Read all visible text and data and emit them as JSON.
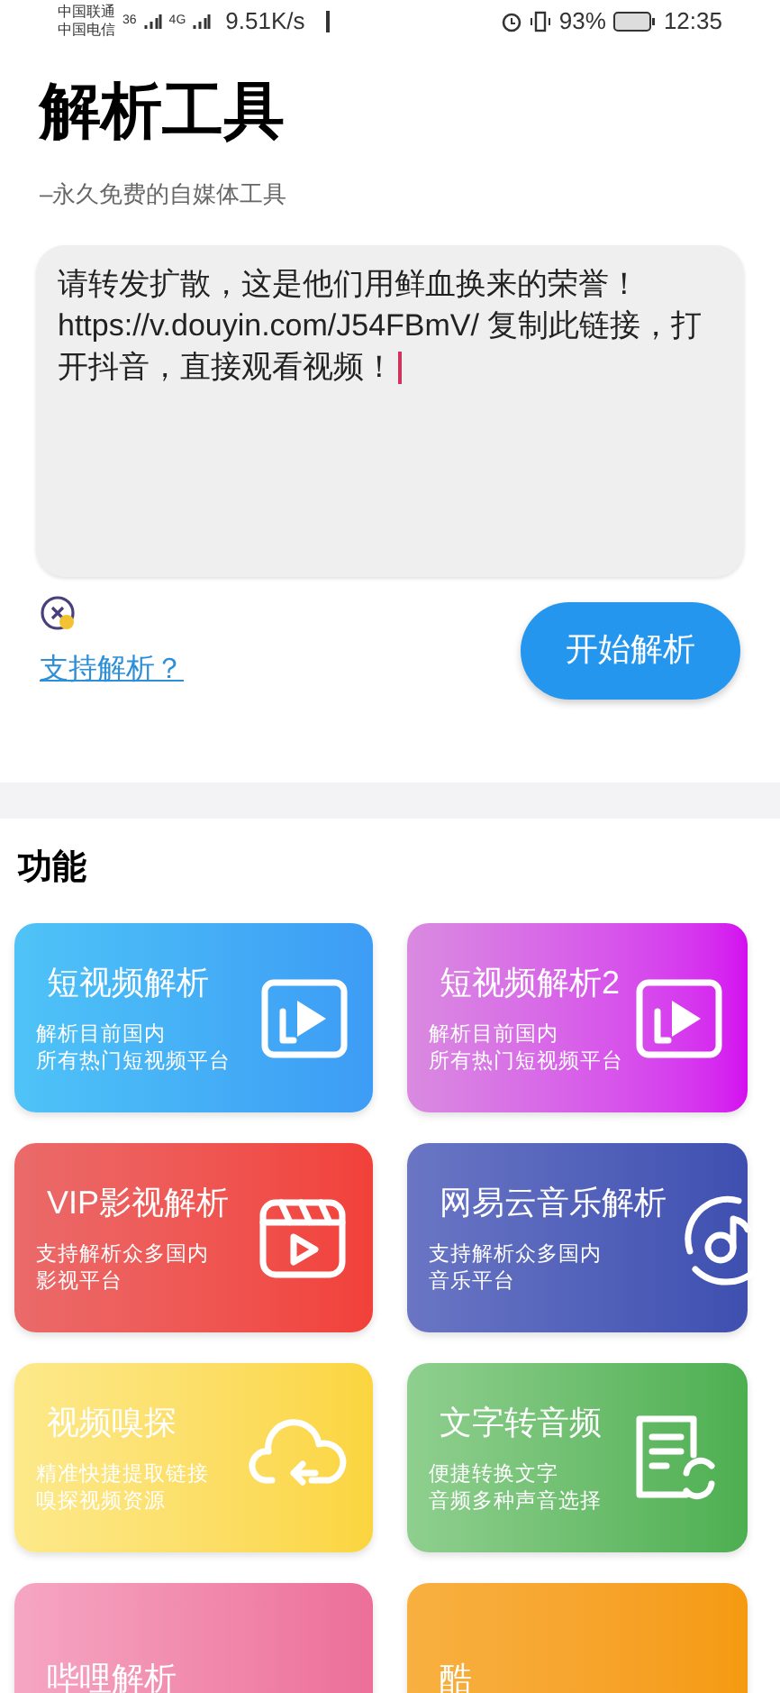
{
  "status_bar": {
    "carrier_1": "中国联通",
    "carrier_2": "中国电信",
    "network_1": "36",
    "network_2": "4G",
    "speed": "9.51K/s",
    "battery": "93%",
    "time": "12:35"
  },
  "header": {
    "title": "解析工具",
    "subtitle": "–永久免费的自媒体工具"
  },
  "input": {
    "value": "请转发扩散，这是他们用鲜血换来的荣誉！https://v.douyin.com/J54FBmV/ 复制此链接，打开抖音，直接观看视频！"
  },
  "support_link": "支持解析？",
  "start_button": "开始解析",
  "section_title": "功能",
  "cards": [
    {
      "title": "短视频解析",
      "description": [
        "解析目前国内",
        "所有热门短视频平台"
      ]
    },
    {
      "title": "短视频解析2",
      "description": [
        "解析目前国内",
        "所有热门短视频平台"
      ]
    },
    {
      "title": "VIP影视解析",
      "description": [
        "支持解析众多国内",
        "影视平台"
      ]
    },
    {
      "title": "网易云音乐解析",
      "description": [
        "支持解析众多国内",
        "音乐平台"
      ]
    },
    {
      "title": "视频嗅探",
      "description": [
        "精准快捷提取链接",
        "嗅探视频资源"
      ]
    },
    {
      "title": "文字转音频",
      "description": [
        "便捷转换文字",
        "音频多种声音选择"
      ]
    },
    {
      "title": "哔哩解析"
    },
    {
      "title": "酷"
    }
  ]
}
